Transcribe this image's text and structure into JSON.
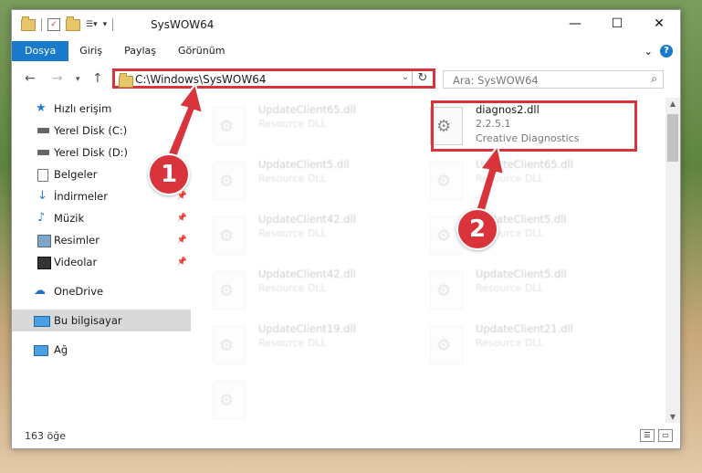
{
  "window": {
    "title": "SysWOW64",
    "controls": {
      "minimize": "—",
      "maximize": "☐",
      "close": "✕"
    }
  },
  "ribbon": {
    "tabs": [
      "Dosya",
      "Giriş",
      "Paylaş",
      "Görünüm"
    ],
    "collapse_glyph": "⌄",
    "help": "?"
  },
  "address": {
    "path": "C:\\Windows\\SysWOW64",
    "search_placeholder": "Ara: SysWOW64"
  },
  "sidebar": {
    "items": [
      {
        "label": "Hızlı erişim",
        "icon": "star-icon",
        "pinned": false
      },
      {
        "label": "Yerel Disk (C:)",
        "icon": "drive-icon",
        "pinned": false
      },
      {
        "label": "Yerel Disk (D:)",
        "icon": "drive-icon",
        "pinned": false
      },
      {
        "label": "Belgeler",
        "icon": "documents-icon",
        "pinned": false
      },
      {
        "label": "İndirmeler",
        "icon": "download-icon",
        "pinned": true
      },
      {
        "label": "Müzik",
        "icon": "music-icon",
        "pinned": true
      },
      {
        "label": "Resimler",
        "icon": "pictures-icon",
        "pinned": true
      },
      {
        "label": "Videolar",
        "icon": "video-icon",
        "pinned": true
      },
      {
        "label": "OneDrive",
        "icon": "cloud-icon",
        "pinned": false
      },
      {
        "label": "Bu bilgisayar",
        "icon": "computer-icon",
        "pinned": false,
        "selected": true
      },
      {
        "label": "Ağ",
        "icon": "network-icon",
        "pinned": false
      }
    ]
  },
  "files": {
    "highlighted": {
      "name": "diagnos2.dll",
      "version": "2.2.5.1",
      "company": "Creative Diagnostics"
    },
    "left": [
      {
        "name": "UpdateClient65.dll",
        "type": "Resource DLL"
      },
      {
        "name": "UpdateClient5.dll",
        "type": "Resource DLL"
      },
      {
        "name": "UpdateClient42.dll",
        "type": "Resource DLL"
      },
      {
        "name": "UpdateClient42.dll",
        "type": "Resource DLL"
      },
      {
        "name": "UpdateClient19.dll",
        "type": "Resource DLL"
      },
      {
        "name": "",
        "type": ""
      }
    ],
    "right": [
      {
        "name": "UpdateClient65.dll",
        "type": "Resource DLL"
      },
      {
        "name": "UpdateClient5.dll",
        "type": "Resource DLL"
      },
      {
        "name": "UpdateClient5.dll",
        "type": "Resource DLL"
      },
      {
        "name": "UpdateClient21.dll",
        "type": "Resource DLL"
      }
    ]
  },
  "status": {
    "count": "163 öğe"
  },
  "callouts": {
    "one": "1",
    "two": "2",
    "color": "#d9343c"
  }
}
